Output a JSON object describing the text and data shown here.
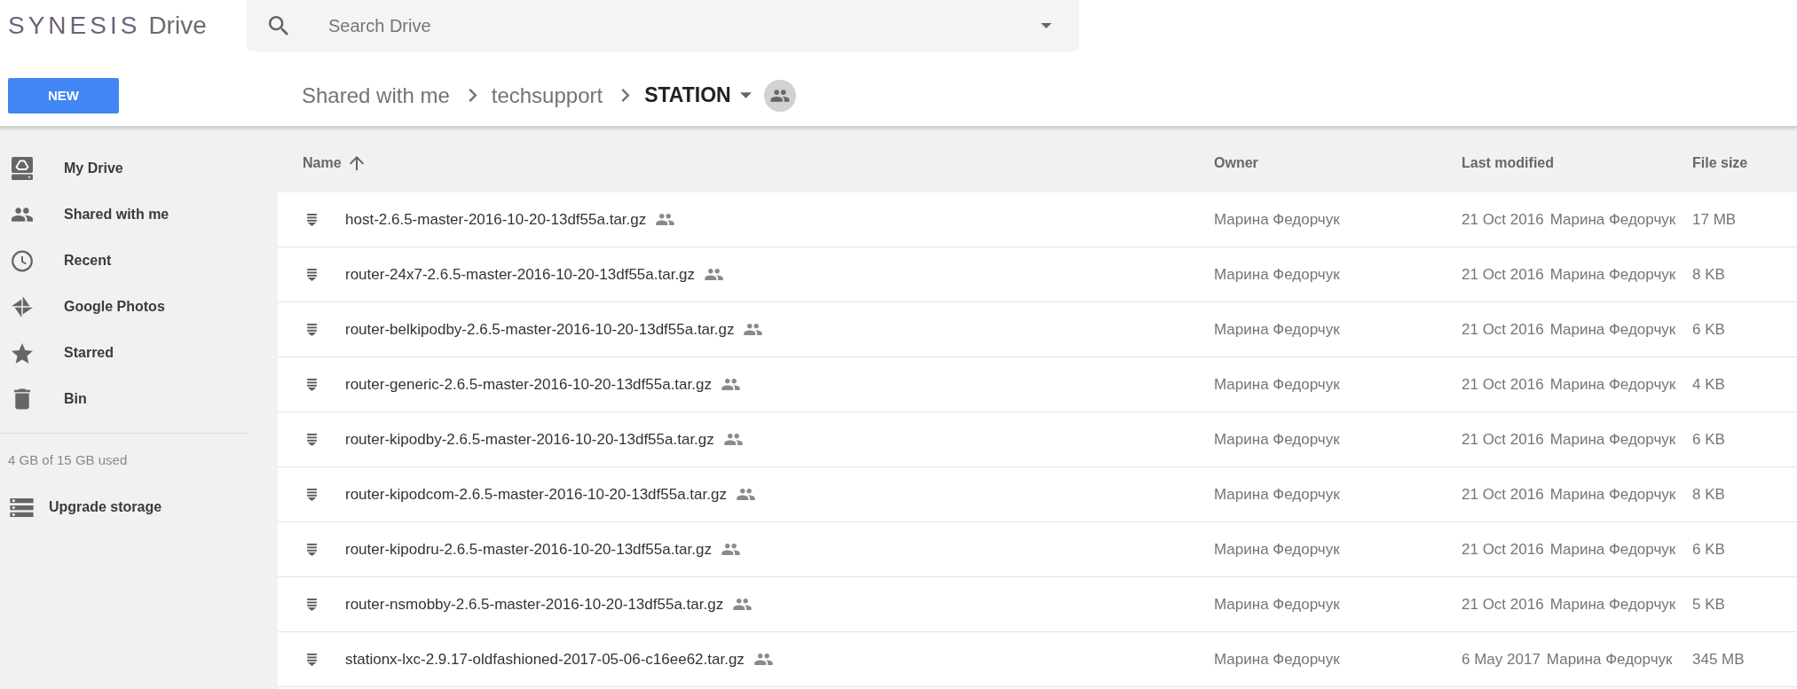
{
  "header": {
    "logo": {
      "brand": "SYNESIS",
      "product": "Drive"
    },
    "search": {
      "placeholder": "Search Drive"
    }
  },
  "toolbar": {
    "new_button": "NEW",
    "breadcrumb": [
      {
        "label": "Shared with me",
        "current": false,
        "shared": false
      },
      {
        "label": "techsupport",
        "current": false,
        "shared": false
      },
      {
        "label": "STATION",
        "current": true,
        "shared": true
      }
    ]
  },
  "sidebar": {
    "items": [
      {
        "label": "My Drive",
        "selected": false
      },
      {
        "label": "Shared with me",
        "selected": false
      },
      {
        "label": "Recent",
        "selected": false
      },
      {
        "label": "Google Photos",
        "selected": false
      },
      {
        "label": "Starred",
        "selected": false
      },
      {
        "label": "Bin",
        "selected": false
      }
    ],
    "storage": "4 GB of 15 GB used",
    "upgrade": "Upgrade storage"
  },
  "table": {
    "columns": [
      {
        "label": "Name",
        "sorted": true
      },
      {
        "label": "Owner",
        "sorted": false
      },
      {
        "label": "Last modified",
        "sorted": false
      },
      {
        "label": "File size",
        "sorted": false
      }
    ],
    "rows": [
      {
        "name": "host-2.6.5-master-2016-10-20-13df55a.tar.gz",
        "shared": true,
        "owner": "Марина Федорчук",
        "modified": "21 Oct 2016",
        "modified_by": "Марина Федорчук",
        "size": "17 MB"
      },
      {
        "name": "router-24x7-2.6.5-master-2016-10-20-13df55a.tar.gz",
        "shared": true,
        "owner": "Марина Федорчук",
        "modified": "21 Oct 2016",
        "modified_by": "Марина Федорчук",
        "size": "8 KB"
      },
      {
        "name": "router-belkipodby-2.6.5-master-2016-10-20-13df55a.tar.gz",
        "shared": true,
        "owner": "Марина Федорчук",
        "modified": "21 Oct 2016",
        "modified_by": "Марина Федорчук",
        "size": "6 KB"
      },
      {
        "name": "router-generic-2.6.5-master-2016-10-20-13df55a.tar.gz",
        "shared": true,
        "owner": "Марина Федорчук",
        "modified": "21 Oct 2016",
        "modified_by": "Марина Федорчук",
        "size": "4 KB"
      },
      {
        "name": "router-kipodby-2.6.5-master-2016-10-20-13df55a.tar.gz",
        "shared": true,
        "owner": "Марина Федорчук",
        "modified": "21 Oct 2016",
        "modified_by": "Марина Федорчук",
        "size": "6 KB"
      },
      {
        "name": "router-kipodcom-2.6.5-master-2016-10-20-13df55a.tar.gz",
        "shared": true,
        "owner": "Марина Федорчук",
        "modified": "21 Oct 2016",
        "modified_by": "Марина Федорчук",
        "size": "8 KB"
      },
      {
        "name": "router-kipodru-2.6.5-master-2016-10-20-13df55a.tar.gz",
        "shared": true,
        "owner": "Марина Федорчук",
        "modified": "21 Oct 2016",
        "modified_by": "Марина Федорчук",
        "size": "6 KB"
      },
      {
        "name": "router-nsmobby-2.6.5-master-2016-10-20-13df55a.tar.gz",
        "shared": true,
        "owner": "Марина Федорчук",
        "modified": "21 Oct 2016",
        "modified_by": "Марина Федорчук",
        "size": "5 KB"
      },
      {
        "name": "stationx-lxc-2.9.17-oldfashioned-2017-05-06-c16ee62.tar.gz",
        "shared": true,
        "owner": "Марина Федорчук",
        "modified": "6 May 2017",
        "modified_by": "Марина Федорчук",
        "size": "345 MB"
      }
    ]
  }
}
